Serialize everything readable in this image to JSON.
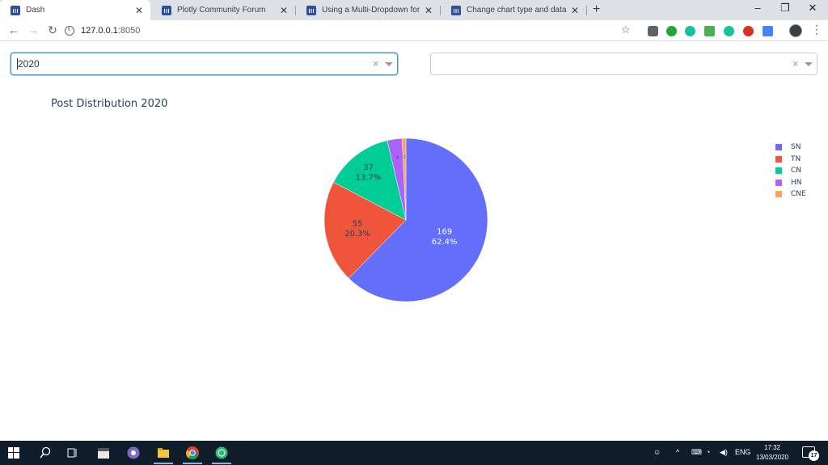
{
  "browser": {
    "tabs": [
      {
        "title": "Dash",
        "active": true
      },
      {
        "title": "Plotly Community Forum",
        "active": false
      },
      {
        "title": "Using a Multi-Dropdown for an A",
        "active": false
      },
      {
        "title": "Change chart type and data usin",
        "active": false
      }
    ],
    "url_host": "127.0.0.1",
    "url_port": ":8050",
    "new_tab_symbol": "+"
  },
  "dropdowns": [
    {
      "value": "2020",
      "focused": true
    },
    {
      "value": "",
      "focused": false
    }
  ],
  "chart_data": {
    "type": "pie",
    "title": "Post Distribution 2020",
    "labels": [
      "SN",
      "TN",
      "CN",
      "HN",
      "CNE"
    ],
    "values": [
      169,
      55,
      37,
      8,
      2
    ],
    "percent_labels": [
      "62.4%",
      "20.3%",
      "13.7%",
      "",
      ""
    ],
    "colors": [
      "#636efa",
      "#ef553b",
      "#00cc96",
      "#ab63fa",
      "#ffa15a"
    ],
    "textinfo": "value+percent",
    "legend_position": "top-right"
  },
  "taskbar": {
    "time": "17:32",
    "date": "13/03/2020",
    "language": "ENG",
    "notification_count": "17"
  }
}
